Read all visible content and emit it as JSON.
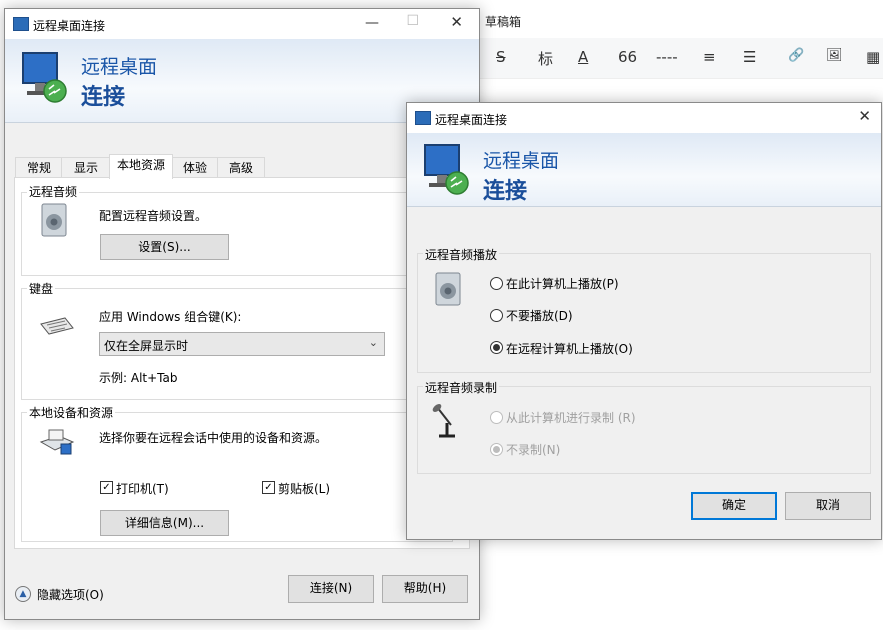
{
  "editor": {
    "title": "草稿箱",
    "toolbar": {
      "strike": "S",
      "heading": "标",
      "font_color": "A",
      "quote": "66",
      "hr": "----",
      "align": "≡",
      "list": "☰",
      "link": "🔗",
      "image": "🖼",
      "more": "▦"
    }
  },
  "main_window": {
    "title": "远程桌面连接",
    "banner_line1": "远程桌面",
    "banner_line2": "连接",
    "tabs": [
      "常规",
      "显示",
      "本地资源",
      "体验",
      "高级"
    ],
    "active_tab": "本地资源",
    "audio": {
      "group": "远程音频",
      "description": "配置远程音频设置。",
      "settings_button": "设置(S)..."
    },
    "keyboard": {
      "group": "键盘",
      "label": "应用 Windows 组合键(K):",
      "selected": "仅在全屏显示时",
      "example": "示例: Alt+Tab"
    },
    "local_devices": {
      "group": "本地设备和资源",
      "description": "选择你要在远程会话中使用的设备和资源。",
      "printer_label": "打印机(T)",
      "printer_checked": true,
      "clipboard_label": "剪贴板(L)",
      "clipboard_checked": true,
      "details_button": "详细信息(M)..."
    },
    "hide_options": "隐藏选项(O)",
    "connect_button": "连接(N)",
    "help_button": "帮助(H)"
  },
  "audio_dialog": {
    "title": "远程桌面连接",
    "banner_line1": "远程桌面",
    "banner_line2": "连接",
    "playback": {
      "group": "远程音频播放",
      "options": [
        {
          "label": "在此计算机上播放(P)",
          "checked": false,
          "enabled": true
        },
        {
          "label": "不要播放(D)",
          "checked": false,
          "enabled": true
        },
        {
          "label": "在远程计算机上播放(O)",
          "checked": true,
          "enabled": true
        }
      ]
    },
    "recording": {
      "group": "远程音频录制",
      "options": [
        {
          "label": "从此计算机进行录制 (R)",
          "checked": false,
          "enabled": false
        },
        {
          "label": "不录制(N)",
          "checked": true,
          "enabled": false
        }
      ]
    },
    "ok_button": "确定",
    "cancel_button": "取消"
  }
}
